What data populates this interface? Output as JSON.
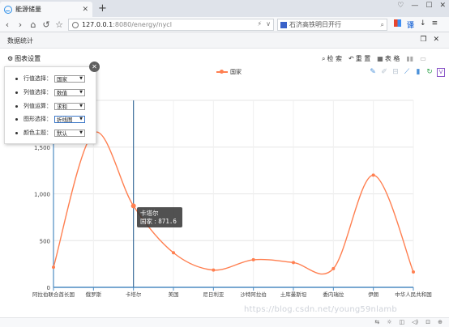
{
  "browser": {
    "tab_title": "能源储量",
    "tab_close": "✕",
    "new_tab": "+",
    "window_controls": [
      "♡",
      "—",
      "☐",
      "✕"
    ],
    "nav_buttons": [
      "‹",
      "›",
      "⌂",
      "↺",
      "☆"
    ],
    "url_main": "127.0.0.1",
    "url_rest": ":8080/energy/nycl",
    "url_extras": [
      "⚡",
      "∨"
    ],
    "search_text": "石济高铁明日开行",
    "search_icon": "⌕",
    "ext_icons": [
      "grid-icon",
      "translate-icon",
      "download-icon",
      "menu-icon"
    ],
    "ext_text": [
      "译",
      "↓",
      "≡"
    ]
  },
  "page": {
    "title": "数据统计",
    "actions": [
      "❐",
      "✕"
    ],
    "settings_label": "图表设置",
    "toolbar": [
      {
        "icon": "⌕",
        "label": "检 索",
        "disabled": false
      },
      {
        "icon": "↶",
        "label": "重 置",
        "disabled": false
      },
      {
        "icon": "▦",
        "label": "表 格",
        "disabled": false
      },
      {
        "icon": "▮▮",
        "label": "",
        "disabled": true
      },
      {
        "icon": "▭",
        "label": "",
        "disabled": true
      }
    ]
  },
  "popup": {
    "close": "✕",
    "rows": [
      {
        "label": "行值选择：",
        "value": "国家"
      },
      {
        "label": "列值选择：",
        "value": "数值"
      },
      {
        "label": "列值运算：",
        "value": "求和"
      },
      {
        "label": "图形选择：",
        "value": "折线图"
      },
      {
        "label": "颜色主题：",
        "value": "默认"
      }
    ]
  },
  "chart_icons": [
    {
      "name": "mark-icon",
      "glyph": "✎",
      "color": "#4a90d9"
    },
    {
      "name": "erase-icon",
      "glyph": "✐",
      "color": "#b9c4d0"
    },
    {
      "name": "data-view-icon",
      "glyph": "⊟",
      "color": "#b9c4d0"
    },
    {
      "name": "line-chart-icon",
      "glyph": "⟋",
      "color": "#4a90d9"
    },
    {
      "name": "bar-chart-icon",
      "glyph": "▮",
      "color": "#4a90d9"
    },
    {
      "name": "refresh-icon",
      "glyph": "↻",
      "color": "#3aaa55"
    },
    {
      "name": "save-image-icon",
      "glyph": "V",
      "color": "#8a56c8"
    }
  ],
  "tooltip": {
    "title": "卡塔尔",
    "series": "国家",
    "value": "871.6"
  },
  "watermark": "https://blog.csdn.net/young59nlamb",
  "status_icons": [
    "⇆",
    "☼",
    "◫",
    "◁)",
    "⊡",
    "⊕"
  ],
  "chart_data": {
    "type": "line",
    "title": "",
    "xlabel": "",
    "ylabel": "",
    "categories": [
      "阿拉伯联合酋长国",
      "俄罗斯",
      "卡塔尔",
      "美国",
      "尼日利亚",
      "沙特阿拉伯",
      "土库曼斯坦",
      "委内瑞拉",
      "伊朗",
      "中华人民共和国"
    ],
    "series": [
      {
        "name": "国家",
        "values": [
          215,
          1650,
          871.6,
          370,
          185,
          295,
          265,
          200,
          1200,
          165
        ]
      }
    ],
    "ylim": [
      0,
      2000
    ],
    "yticks": [
      0,
      500,
      1000,
      1500
    ],
    "ytick_labels": [
      "0",
      "500",
      "1,000",
      "1,500"
    ],
    "legend": "top-center",
    "grid": true,
    "smooth": true,
    "highlight_category": "卡塔尔",
    "color": "#ff7f50"
  }
}
